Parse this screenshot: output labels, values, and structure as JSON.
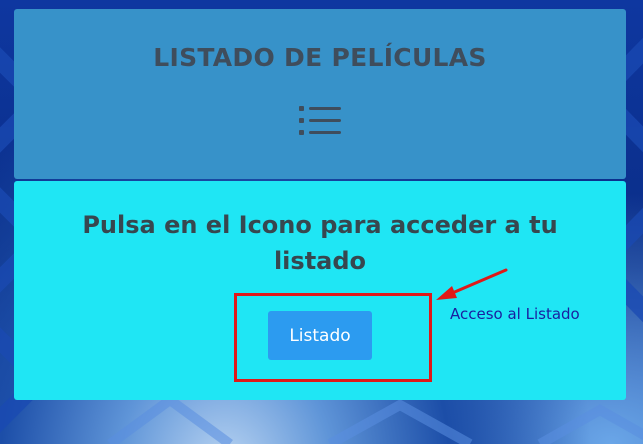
{
  "header": {
    "title": "LISTADO DE PELÍCULAS",
    "icon": "list-icon"
  },
  "main": {
    "prompt": "Pulsa en el Icono para acceder a tu listado",
    "button_label": "Listado"
  },
  "annotation": {
    "label": "Acceso al Listado",
    "color": "#e01818"
  },
  "colors": {
    "header_bg": "#3792c9",
    "content_bg": "#1fe6f4",
    "button_bg": "#2c9bf0",
    "text": "#3f4d5c"
  }
}
